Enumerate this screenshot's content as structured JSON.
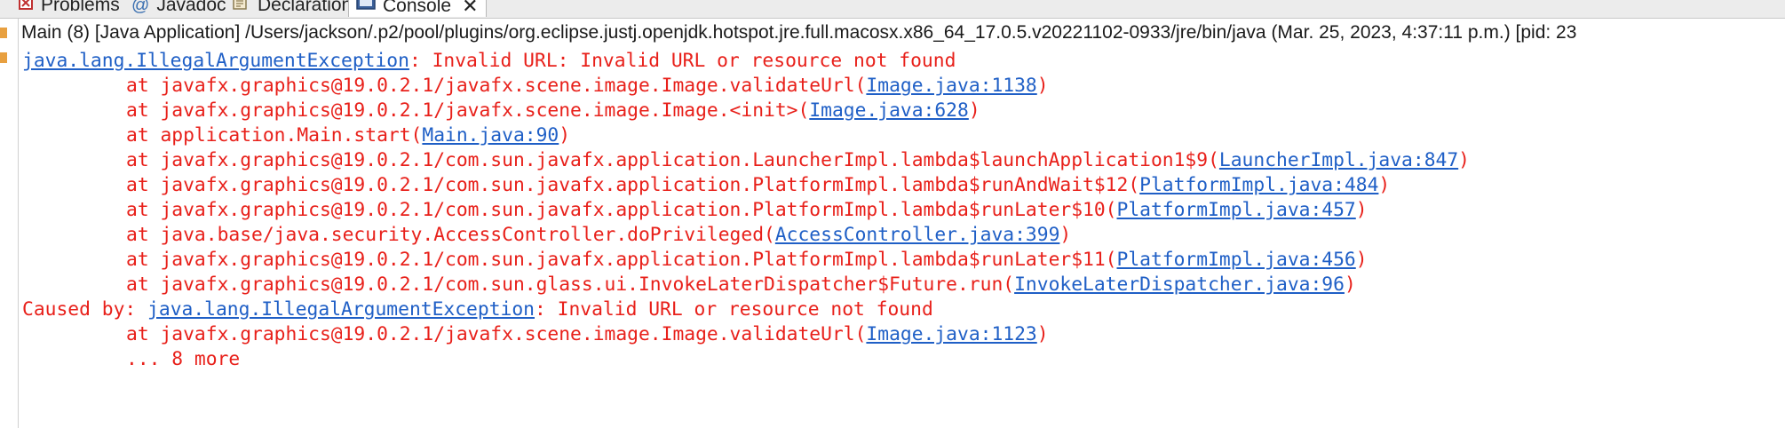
{
  "tabs": [
    {
      "name": "Problems",
      "icon": "problems-icon",
      "active": false
    },
    {
      "name": "Javadoc",
      "icon": "at-icon",
      "active": false
    },
    {
      "name": "Declaration",
      "icon": "declaration-icon",
      "active": false
    },
    {
      "name": "Console",
      "icon": "console-icon",
      "active": true
    }
  ],
  "close_glyph": "✕",
  "console": {
    "header": "Main (8) [Java Application] /Users/jackson/.p2/pool/plugins/org.eclipse.justj.openjdk.hotspot.jre.full.macosx.x86_64_17.0.5.v20221102-0933/jre/bin/java  (Mar. 25, 2023, 4:37:11 p.m.) [pid: 23",
    "lines": [
      {
        "prefix": "",
        "link": "java.lang.IllegalArgumentException",
        "suffix": ": Invalid URL: Invalid URL or resource not found"
      },
      {
        "prefix": "at javafx.graphics@19.0.2.1/javafx.scene.image.Image.validateUrl(",
        "link": "Image.java:1138",
        "suffix": ")"
      },
      {
        "prefix": "at javafx.graphics@19.0.2.1/javafx.scene.image.Image.<init>(",
        "link": "Image.java:628",
        "suffix": ")"
      },
      {
        "prefix": "at application.Main.start(",
        "link": "Main.java:90",
        "suffix": ")"
      },
      {
        "prefix": "at javafx.graphics@19.0.2.1/com.sun.javafx.application.LauncherImpl.lambda$launchApplication1$9(",
        "link": "LauncherImpl.java:847",
        "suffix": ")"
      },
      {
        "prefix": "at javafx.graphics@19.0.2.1/com.sun.javafx.application.PlatformImpl.lambda$runAndWait$12(",
        "link": "PlatformImpl.java:484",
        "suffix": ")"
      },
      {
        "prefix": "at javafx.graphics@19.0.2.1/com.sun.javafx.application.PlatformImpl.lambda$runLater$10(",
        "link": "PlatformImpl.java:457",
        "suffix": ")"
      },
      {
        "prefix": "at java.base/java.security.AccessController.doPrivileged(",
        "link": "AccessController.java:399",
        "suffix": ")"
      },
      {
        "prefix": "at javafx.graphics@19.0.2.1/com.sun.javafx.application.PlatformImpl.lambda$runLater$11(",
        "link": "PlatformImpl.java:456",
        "suffix": ")"
      },
      {
        "prefix": "at javafx.graphics@19.0.2.1/com.sun.glass.ui.InvokeLaterDispatcher$Future.run(",
        "link": "InvokeLaterDispatcher.java:96",
        "suffix": ")"
      },
      {
        "prefix": "Caused by: ",
        "link": "java.lang.IllegalArgumentException",
        "suffix": ": Invalid URL or resource not found"
      },
      {
        "prefix": "at javafx.graphics@19.0.2.1/javafx.scene.image.Image.validateUrl(",
        "link": "Image.java:1123",
        "suffix": ")"
      },
      {
        "prefix": "... 8 more",
        "link": "",
        "suffix": ""
      }
    ]
  },
  "colors": {
    "error_text": "#e8201a",
    "link": "#1f5fc6"
  }
}
